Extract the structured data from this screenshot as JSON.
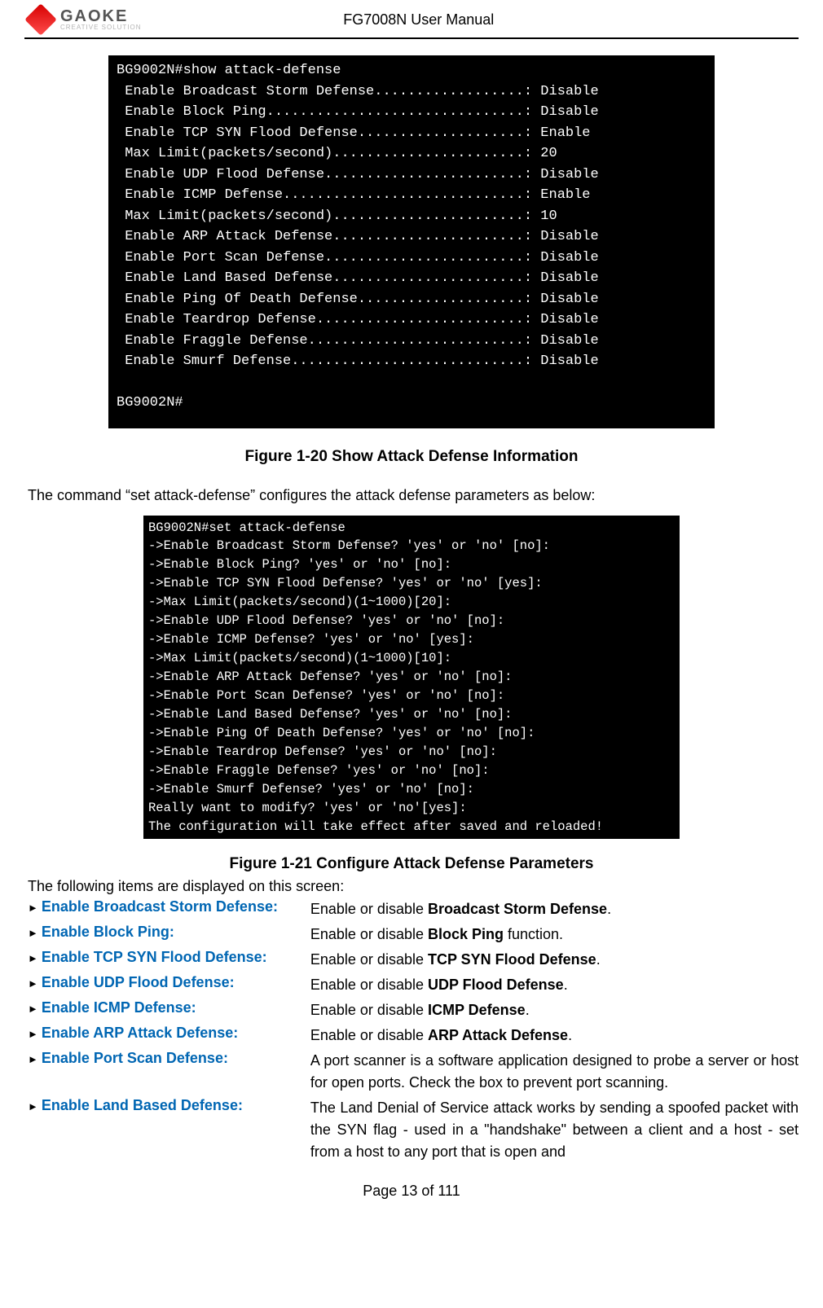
{
  "header": {
    "logo_name": "GAOKE",
    "logo_sub": "CREATIVE SOLUTION",
    "doc_title": "FG7008N User Manual"
  },
  "terminal1": "BG9002N#show attack-defense\n Enable Broadcast Storm Defense..................: Disable\n Enable Block Ping...............................: Disable\n Enable TCP SYN Flood Defense....................: Enable\n Max Limit(packets/second).......................: 20\n Enable UDP Flood Defense........................: Disable\n Enable ICMP Defense.............................: Enable\n Max Limit(packets/second).......................: 10\n Enable ARP Attack Defense.......................: Disable\n Enable Port Scan Defense........................: Disable\n Enable Land Based Defense.......................: Disable\n Enable Ping Of Death Defense....................: Disable\n Enable Teardrop Defense.........................: Disable\n Enable Fraggle Defense..........................: Disable\n Enable Smurf Defense............................: Disable\n\nBG9002N#",
  "caption1": "Figure 1-20    Show Attack Defense Information",
  "intro1": "The command “set attack-defense” configures the attack defense parameters as below:",
  "terminal2": "BG9002N#set attack-defense\n->Enable Broadcast Storm Defense? 'yes' or 'no' [no]:\n->Enable Block Ping? 'yes' or 'no' [no]:\n->Enable TCP SYN Flood Defense? 'yes' or 'no' [yes]:\n->Max Limit(packets/second)(1~1000)[20]:\n->Enable UDP Flood Defense? 'yes' or 'no' [no]:\n->Enable ICMP Defense? 'yes' or 'no' [yes]:\n->Max Limit(packets/second)(1~1000)[10]:\n->Enable ARP Attack Defense? 'yes' or 'no' [no]:\n->Enable Port Scan Defense? 'yes' or 'no' [no]:\n->Enable Land Based Defense? 'yes' or 'no' [no]:\n->Enable Ping Of Death Defense? 'yes' or 'no' [no]:\n->Enable Teardrop Defense? 'yes' or 'no' [no]:\n->Enable Fraggle Defense? 'yes' or 'no' [no]:\n->Enable Smurf Defense? 'yes' or 'no' [no]:\nReally want to modify? 'yes' or 'no'[yes]:\nThe configuration will take effect after saved and reloaded!",
  "caption2": "Figure 1-21    Configure Attack Defense Parameters",
  "intro2": "The following items are displayed on this screen:",
  "params": [
    {
      "label": "Enable Broadcast Storm Defense:",
      "desc_pre": "Enable or disable ",
      "desc_bold": "Broadcast Storm Defense",
      "desc_post": "."
    },
    {
      "label": "Enable Block Ping:",
      "desc_pre": "Enable or disable ",
      "desc_bold": "Block Ping",
      "desc_post": " function."
    },
    {
      "label": "Enable TCP SYN Flood Defense:",
      "desc_pre": "Enable or disable ",
      "desc_bold": "TCP SYN Flood Defense",
      "desc_post": "."
    },
    {
      "label": "Enable UDP Flood Defense:",
      "desc_pre": "Enable or disable ",
      "desc_bold": "UDP Flood Defense",
      "desc_post": "."
    },
    {
      "label": "Enable ICMP Defense:",
      "desc_pre": "Enable or disable ",
      "desc_bold": "ICMP Defense",
      "desc_post": "."
    },
    {
      "label": "Enable ARP Attack Defense:",
      "desc_pre": "Enable or disable ",
      "desc_bold": "ARP Attack Defense",
      "desc_post": "."
    },
    {
      "label": "Enable Port Scan Defense:",
      "desc_plain": "A port scanner is a software application designed to probe a server or host for open ports. Check the box to prevent port scanning."
    },
    {
      "label": "Enable Land Based Defense:",
      "desc_plain": "The Land Denial of Service attack works by sending a spoofed packet with the SYN flag - used in a \"handshake\" between a client and a host - set from a host to any port that is open and"
    }
  ],
  "footer": "Page 13 of 111"
}
